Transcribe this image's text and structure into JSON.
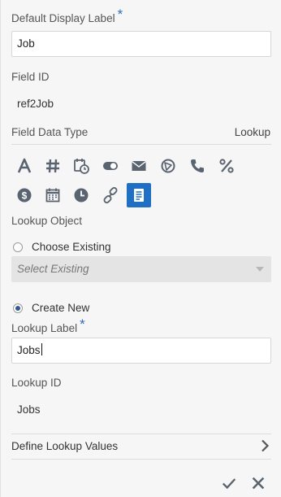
{
  "form": {
    "default_display_label": {
      "label": "Default Display Label",
      "required_mark": "*",
      "value": "Job"
    },
    "field_id": {
      "label": "Field ID",
      "value": "ref2Job"
    },
    "field_data_type": {
      "label": "Field Data Type",
      "value": "Lookup"
    },
    "type_icons": [
      {
        "name": "text-type-icon",
        "selected": false
      },
      {
        "name": "number-type-icon",
        "selected": false
      },
      {
        "name": "datetime-type-icon",
        "selected": false
      },
      {
        "name": "toggle-type-icon",
        "selected": false
      },
      {
        "name": "email-type-icon",
        "selected": false
      },
      {
        "name": "url-type-icon",
        "selected": false
      },
      {
        "name": "phone-type-icon",
        "selected": false
      },
      {
        "name": "percent-type-icon",
        "selected": false
      },
      {
        "name": "currency-type-icon",
        "selected": false
      },
      {
        "name": "date-type-icon",
        "selected": false
      },
      {
        "name": "time-type-icon",
        "selected": false
      },
      {
        "name": "reference-link-type-icon",
        "selected": false
      },
      {
        "name": "lookup-list-type-icon",
        "selected": true
      }
    ],
    "lookup_object": {
      "label": "Lookup Object",
      "choose_existing": {
        "label": "Choose Existing",
        "checked": false,
        "placeholder": "Select Existing"
      },
      "create_new": {
        "label": "Create New",
        "checked": true
      }
    },
    "lookup_label": {
      "label": "Lookup Label",
      "required_mark": "*",
      "value": "Jobs"
    },
    "lookup_id": {
      "label": "Lookup ID",
      "value": "Jobs"
    },
    "define_lookup_values": {
      "label": "Define Lookup Values",
      "icon": "chevron-right-icon"
    }
  },
  "actions": {
    "confirm_icon": "checkmark-icon",
    "cancel_icon": "close-icon"
  },
  "colors": {
    "accent": "#1f6fc5",
    "required": "#2d6fb7",
    "icon": "#5a6470"
  }
}
